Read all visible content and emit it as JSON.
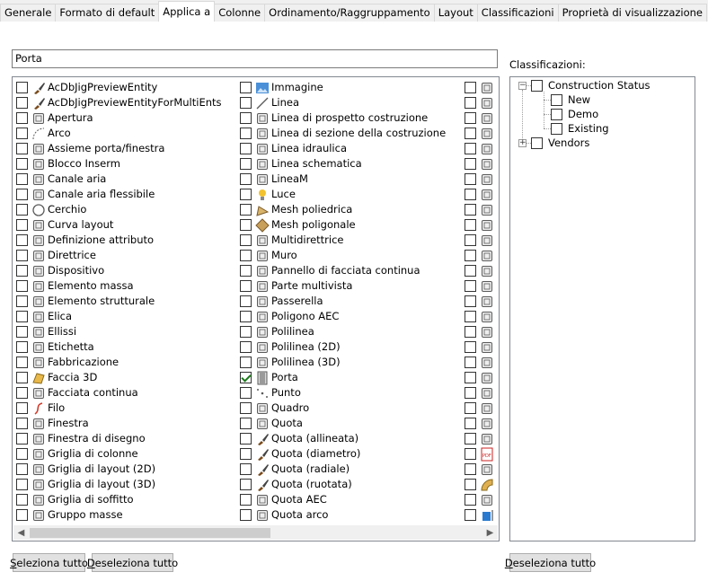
{
  "tabs": [
    {
      "label": "Generale"
    },
    {
      "label": "Formato di default"
    },
    {
      "label": "Applica a"
    },
    {
      "label": "Colonne"
    },
    {
      "label": "Ordinamento/Raggruppamento"
    },
    {
      "label": "Layout"
    },
    {
      "label": "Classificazioni"
    },
    {
      "label": "Proprietà di visualizzazione"
    }
  ],
  "active_tab": "Applica a",
  "filter": {
    "value": "Porta"
  },
  "objects": {
    "col1": [
      {
        "label": "AcDbJigPreviewEntity",
        "icon": "brush-icon",
        "checked": false
      },
      {
        "label": "AcDbJigPreviewEntityForMultiEnts",
        "icon": "brush-icon",
        "checked": false
      },
      {
        "label": "Apertura",
        "icon": "opening-icon",
        "checked": false
      },
      {
        "label": "Arco",
        "icon": "arc-icon",
        "checked": false
      },
      {
        "label": "Assieme porta/finestra",
        "icon": "door-window-assembly-icon",
        "checked": false
      },
      {
        "label": "Blocco Inserm",
        "icon": "block-icon",
        "checked": false
      },
      {
        "label": "Canale aria",
        "icon": "duct-icon",
        "checked": false
      },
      {
        "label": "Canale aria flessibile",
        "icon": "flex-duct-icon",
        "checked": false
      },
      {
        "label": "Cerchio",
        "icon": "circle-icon",
        "checked": false
      },
      {
        "label": "Curva layout",
        "icon": "layout-curve-icon",
        "checked": false
      },
      {
        "label": "Definizione attributo",
        "icon": "attribute-definition-icon",
        "checked": false
      },
      {
        "label": "Direttrice",
        "icon": "leader-icon",
        "checked": false
      },
      {
        "label": "Dispositivo",
        "icon": "device-icon",
        "checked": false
      },
      {
        "label": "Elemento massa",
        "icon": "mass-element-icon",
        "checked": false
      },
      {
        "label": "Elemento strutturale",
        "icon": "structural-member-icon",
        "checked": false
      },
      {
        "label": "Elica",
        "icon": "helix-icon",
        "checked": false
      },
      {
        "label": "Ellissi",
        "icon": "ellipse-icon",
        "checked": false
      },
      {
        "label": "Etichetta",
        "icon": "label-icon",
        "checked": false
      },
      {
        "label": "Fabbricazione",
        "icon": "fabrication-icon",
        "checked": false
      },
      {
        "label": "Faccia 3D",
        "icon": "face-3d-icon",
        "checked": false
      },
      {
        "label": "Facciata continua",
        "icon": "curtain-wall-icon",
        "checked": false
      },
      {
        "label": "Filo",
        "icon": "wire-icon",
        "checked": false
      },
      {
        "label": "Finestra",
        "icon": "window-icon",
        "checked": false
      },
      {
        "label": "Finestra di disegno",
        "icon": "viewport-icon",
        "checked": false
      },
      {
        "label": "Griglia di colonne",
        "icon": "column-grid-icon",
        "checked": false
      },
      {
        "label": "Griglia di layout (2D)",
        "icon": "layout-grid-2d-icon",
        "checked": false
      },
      {
        "label": "Griglia di layout (3D)",
        "icon": "layout-grid-3d-icon",
        "checked": false
      },
      {
        "label": "Griglia di soffitto",
        "icon": "ceiling-grid-icon",
        "checked": false
      },
      {
        "label": "Gruppo masse",
        "icon": "mass-group-icon",
        "checked": false
      }
    ],
    "col2": [
      {
        "label": "Immagine",
        "icon": "image-icon",
        "checked": false
      },
      {
        "label": "Linea",
        "icon": "line-icon",
        "checked": false
      },
      {
        "label": "Linea di prospetto costruzione",
        "icon": "elevation-line-icon",
        "checked": false
      },
      {
        "label": "Linea di sezione della costruzione",
        "icon": "section-line-icon",
        "checked": false
      },
      {
        "label": "Linea idraulica",
        "icon": "pipe-line-icon",
        "checked": false
      },
      {
        "label": "Linea schematica",
        "icon": "schematic-line-icon",
        "checked": false
      },
      {
        "label": "LineaM",
        "icon": "mline-icon",
        "checked": false
      },
      {
        "label": "Luce",
        "icon": "light-icon",
        "checked": false
      },
      {
        "label": "Mesh poliedrica",
        "icon": "polyface-mesh-icon",
        "checked": false
      },
      {
        "label": "Mesh poligonale",
        "icon": "polygon-mesh-icon",
        "checked": false
      },
      {
        "label": "Multidirettrice",
        "icon": "multileader-icon",
        "checked": false
      },
      {
        "label": "Muro",
        "icon": "wall-icon",
        "checked": false
      },
      {
        "label": "Pannello di facciata continua",
        "icon": "curtain-panel-icon",
        "checked": false
      },
      {
        "label": "Parte multivista",
        "icon": "multiview-part-icon",
        "checked": false
      },
      {
        "label": "Passerella",
        "icon": "walkway-icon",
        "checked": false
      },
      {
        "label": "Poligono AEC",
        "icon": "aec-polygon-icon",
        "checked": false
      },
      {
        "label": "Polilinea",
        "icon": "polyline-icon",
        "checked": false
      },
      {
        "label": "Polilinea (2D)",
        "icon": "polyline-2d-icon",
        "checked": false
      },
      {
        "label": "Polilinea (3D)",
        "icon": "polyline-3d-icon",
        "checked": false
      },
      {
        "label": "Porta",
        "icon": "door-icon",
        "checked": true
      },
      {
        "label": "Punto",
        "icon": "point-icon",
        "checked": false
      },
      {
        "label": "Quadro",
        "icon": "panel-icon",
        "checked": false
      },
      {
        "label": "Quota",
        "icon": "dimension-icon",
        "checked": false
      },
      {
        "label": "Quota (allineata)",
        "icon": "brush-icon",
        "checked": false
      },
      {
        "label": "Quota (diametro)",
        "icon": "brush-icon",
        "checked": false
      },
      {
        "label": "Quota (radiale)",
        "icon": "brush-icon",
        "checked": false
      },
      {
        "label": "Quota (ruotata)",
        "icon": "brush-icon",
        "checked": false
      },
      {
        "label": "Quota AEC",
        "icon": "aec-dimension-icon",
        "checked": false
      },
      {
        "label": "Quota arco",
        "icon": "arc-dimension-icon",
        "checked": false
      }
    ],
    "col3": [
      {
        "icon": "cylinder-fitting-icon",
        "checked": false
      },
      {
        "icon": "valve-icon",
        "checked": false
      },
      {
        "icon": "ring-fitting-icon",
        "checked": false
      },
      {
        "icon": "elbow-fitting-icon",
        "checked": false
      },
      {
        "icon": "duct-fitting-icon",
        "checked": false
      },
      {
        "icon": "pipe-bend-icon",
        "checked": false
      },
      {
        "icon": "pipe-run-icon",
        "checked": false
      },
      {
        "icon": "ray-icon",
        "checked": false
      },
      {
        "icon": "region-icon",
        "checked": false
      },
      {
        "icon": "grid-table-icon",
        "checked": false
      },
      {
        "icon": "frame-icon",
        "checked": false
      },
      {
        "icon": "hatch-icon",
        "checked": false
      },
      {
        "icon": "solid-icon",
        "checked": false
      },
      {
        "icon": "roof-icon",
        "checked": false
      },
      {
        "icon": "slab-icon",
        "checked": false
      },
      {
        "icon": "spline-icon",
        "checked": false
      },
      {
        "icon": "stair-icon",
        "checked": false
      },
      {
        "icon": "house-icon",
        "checked": false
      },
      {
        "icon": "house-outline-icon",
        "checked": false
      },
      {
        "icon": "symbol-icon",
        "checked": false
      },
      {
        "icon": "surface-icon",
        "checked": false
      },
      {
        "icon": "tag-icon",
        "checked": false
      },
      {
        "icon": "funnel-icon",
        "checked": false
      },
      {
        "icon": "box-icon",
        "checked": false
      },
      {
        "icon": "pdf-underlay-icon",
        "checked": false
      },
      {
        "icon": "xline-icon",
        "checked": false
      },
      {
        "icon": "zone-icon",
        "checked": false
      },
      {
        "icon": "curved-segment-icon",
        "checked": false
      },
      {
        "icon": "cube-icon",
        "checked": false
      }
    ]
  },
  "classifications": {
    "label": "Classificazioni:",
    "tree": [
      {
        "label": "Construction Status",
        "expanded": true,
        "children": [
          {
            "label": "New"
          },
          {
            "label": "Demo"
          },
          {
            "label": "Existing"
          }
        ]
      },
      {
        "label": "Vendors",
        "expanded": false
      }
    ]
  },
  "buttons": {
    "select_all": "Seleziona tutto",
    "deselect_all": "Deseleziona tutto",
    "deselect_classifications": "Deseleziona tutto"
  },
  "colors": {
    "check_green": "#1a7a1a",
    "accent": "#0078d7"
  }
}
